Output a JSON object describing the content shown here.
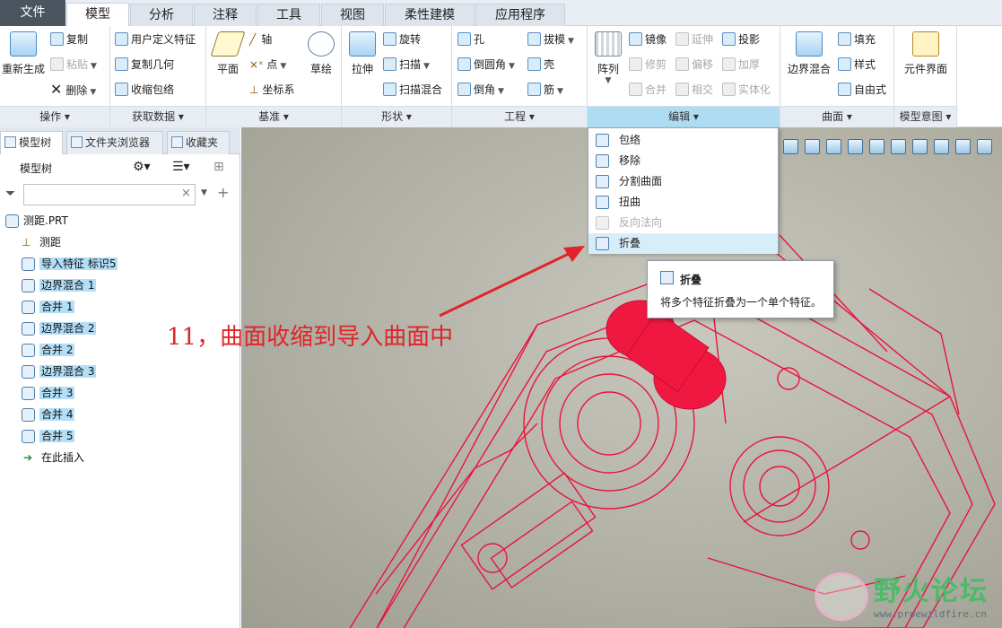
{
  "tabs": [
    {
      "label": "文件"
    },
    {
      "label": "模型"
    },
    {
      "label": "分析"
    },
    {
      "label": "注释"
    },
    {
      "label": "工具"
    },
    {
      "label": "视图"
    },
    {
      "label": "柔性建模"
    },
    {
      "label": "应用程序"
    }
  ],
  "ribbon": {
    "ops": {
      "regen": "重新生成",
      "copy": "复制",
      "paste": "粘贴",
      "delete": "删除",
      "footer": "操作"
    },
    "getdata": {
      "udf": "用户定义特征",
      "copygeom": "复制几何",
      "shrinkwrap": "收缩包络",
      "footer": "获取数据"
    },
    "datum": {
      "plane": "平面",
      "axis": "轴",
      "point": "点",
      "csys": "坐标系",
      "sketch": "草绘",
      "footer": "基准"
    },
    "shapes": {
      "extrude": "拉伸",
      "revolve": "旋转",
      "sweep": "扫描",
      "sweepblend": "扫描混合",
      "footer": "形状"
    },
    "eng": {
      "hole": "孔",
      "round": "倒圆角",
      "chamfer": "倒角",
      "draft": "拔模",
      "shell": "壳",
      "rib": "筋",
      "footer": "工程"
    },
    "edit": {
      "pattern": "阵列",
      "mirror": "镜像",
      "extend": "延伸",
      "project": "投影",
      "trim": "修剪",
      "offset": "偏移",
      "thicken": "加厚",
      "merge": "合并",
      "intersect": "相交",
      "solidify": "实体化",
      "footer": "编辑"
    },
    "surfaces": {
      "boundary": "边界混合",
      "fill": "填充",
      "style": "样式",
      "freestyle": "自由式",
      "footer": "曲面"
    },
    "intent": {
      "component": "元件界面",
      "footer": "模型意图"
    }
  },
  "panel": {
    "tabs": [
      {
        "label": "模型树"
      },
      {
        "label": "文件夹浏览器"
      },
      {
        "label": "收藏夹"
      }
    ],
    "tree_title": "模型树",
    "search_value": "",
    "items": [
      {
        "label": "测距.PRT",
        "selected": false
      },
      {
        "label": "测距",
        "selected": false
      },
      {
        "label": "导入特征 标识5",
        "selected": true
      },
      {
        "label": "边界混合 1",
        "selected": true
      },
      {
        "label": "合并 1",
        "selected": true
      },
      {
        "label": "边界混合 2",
        "selected": true
      },
      {
        "label": "合并 2",
        "selected": true
      },
      {
        "label": "边界混合 3",
        "selected": true
      },
      {
        "label": "合并 3",
        "selected": true
      },
      {
        "label": "合并 4",
        "selected": true
      },
      {
        "label": "合并 5",
        "selected": true
      },
      {
        "label": "在此插入",
        "selected": false
      }
    ]
  },
  "menu": {
    "items": [
      {
        "label": "包络",
        "disabled": false,
        "icon": "wrap-icon"
      },
      {
        "label": "移除",
        "disabled": false,
        "icon": "remove-icon"
      },
      {
        "label": "分割曲面",
        "disabled": false,
        "icon": "split-surface-icon"
      },
      {
        "label": "扭曲",
        "disabled": false,
        "icon": "warp-icon"
      },
      {
        "label": "反向法向",
        "disabled": true,
        "icon": "flip-normal-icon"
      },
      {
        "label": "折叠",
        "disabled": false,
        "highlighted": true,
        "icon": "collapse-icon"
      }
    ]
  },
  "tooltip": {
    "title": "折叠",
    "desc": "将多个特征折叠为一个单个特征。"
  },
  "annotation": "11，曲面收缩到导入曲面中",
  "watermark": {
    "title": "野火论坛",
    "url": "www.proewildfire.cn"
  },
  "colors": {
    "accent": "#aedcf3",
    "annotation": "#e0242a",
    "wireframe": "#e8143c",
    "selection": "#b3def7"
  }
}
